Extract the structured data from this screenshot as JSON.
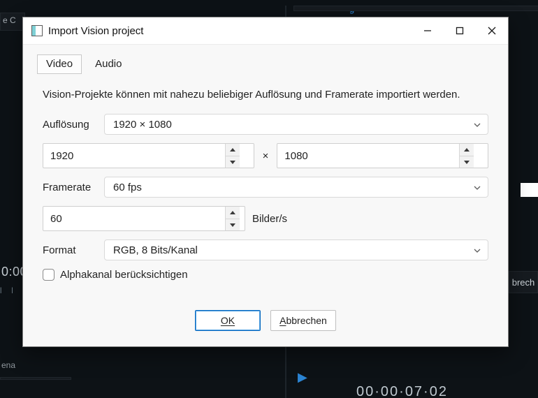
{
  "window": {
    "title": "Import Vision project"
  },
  "tabs": {
    "video": "Video",
    "audio": "Audio"
  },
  "description": "Vision-Projekte können mit nahezu beliebiger Auflösung und Framerate importiert werden.",
  "labels": {
    "resolution": "Auflösung",
    "framerate": "Framerate",
    "format": "Format",
    "frames_unit": "Bilder/s",
    "alpha_checkbox": "Alphakanal berücksichtigen",
    "x_sep": "×"
  },
  "values": {
    "resolution_preset": "1920 × 1080",
    "width": "1920",
    "height": "1080",
    "framerate_preset": "60 fps",
    "framerate_value": "60",
    "format_preset": "RGB, 8 Bits/Kanal",
    "alpha_checked": false
  },
  "buttons": {
    "ok": "OK",
    "cancel": "Abbrechen"
  },
  "system": {
    "minimize": "minimize",
    "maximize": "maximize",
    "close": "close"
  },
  "background_fragments": {
    "tab_blue": "g",
    "left_tab": "e C",
    "left_time": "0:00",
    "right_btn": "brech",
    "right_time": "00·00·07·02",
    "bottom_left": "ena"
  }
}
